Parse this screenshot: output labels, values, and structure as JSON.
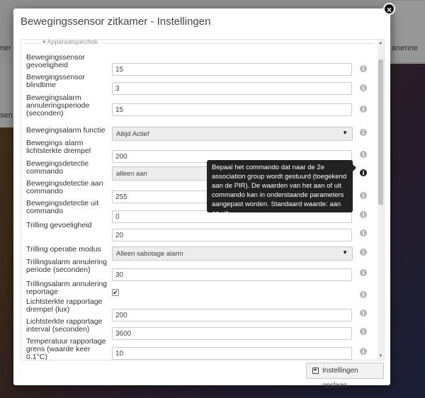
{
  "modal": {
    "title": "Bewegingssensor zitkamer - Instellingen",
    "section_legend": "Apparaatspecifiek",
    "save_label": "Instellingen opslaan"
  },
  "background": {
    "left_text_1": "ner",
    "left_text_2": "sen.",
    "right_text": "anenne"
  },
  "tooltip": {
    "text": "Bepaal het commando dat naar de 2e association group wordt gestuurd (toegekend aan de PIR). De waarden van het aan of uit commando kan in onderstaande parameters aangepast worden. Standaard waarde: aan en uit."
  },
  "fields": [
    {
      "label": "Bewegingssensor gevoeligheid",
      "type": "input",
      "value": "15"
    },
    {
      "label": "Bewegingssensor blindtime",
      "type": "input",
      "value": "3"
    },
    {
      "label": "Bewegingsalarm annuleringsperiode (seconden)",
      "type": "input",
      "value": "15"
    },
    {
      "label": "Bewegingsalarm functie",
      "type": "select",
      "value": "Altijd Actief"
    },
    {
      "label": "Bewegings alarm lichtsterkte drempel",
      "type": "input",
      "value": "200"
    },
    {
      "label": "Bewegingsdetectie commando",
      "type": "select",
      "value": "alleen aan"
    },
    {
      "label": "Bewegingsdetectie aan commando",
      "type": "input",
      "value": "255"
    },
    {
      "label": "Bewegingsdetectie uit commando",
      "type": "input",
      "value": "0"
    },
    {
      "label": "Trilling gevoeligheid",
      "type": "input",
      "value": "20"
    },
    {
      "label": "Trilling operatie modus",
      "type": "select",
      "value": "Alleen sabotage alarm"
    },
    {
      "label": "Trillingsalarm annulering periode (seconden)",
      "type": "input",
      "value": "30"
    },
    {
      "label": "Trillingsalarm annulering reportage",
      "type": "checkbox",
      "checked": true
    },
    {
      "label": "Lichtsterkte rapportage drempel (lux)",
      "type": "input",
      "value": "200"
    },
    {
      "label": "Lichtsterkte rapportage interval (seconden)",
      "type": "input",
      "value": "3600"
    },
    {
      "label": "Temperatuur rapportage grens (waarde keer 0.1°C)",
      "type": "input",
      "value": "10"
    }
  ],
  "icons": {
    "info": "i",
    "close": "×",
    "caret": "▼"
  }
}
